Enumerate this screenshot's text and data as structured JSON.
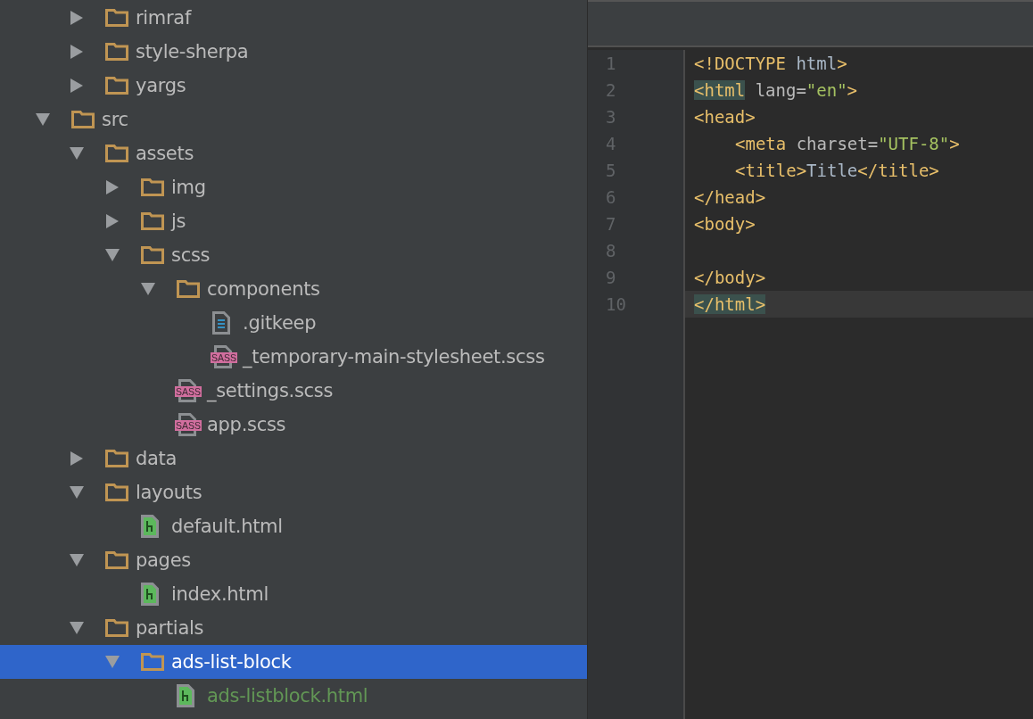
{
  "project_tree": [
    {
      "children": [
        {
          "label": "rimraf",
          "kind": "folder",
          "expanded": false,
          "selected": false
        },
        {
          "label": "style-sherpa",
          "kind": "folder",
          "expanded": false,
          "selected": false
        },
        {
          "label": "yargs",
          "kind": "folder",
          "expanded": false,
          "selected": false
        }
      ]
    },
    {
      "label": "src",
      "kind": "folder",
      "expanded": true,
      "selected": false,
      "children": [
        {
          "label": "assets",
          "kind": "folder",
          "expanded": true,
          "selected": false,
          "children": [
            {
              "label": "img",
              "kind": "folder",
              "expanded": false,
              "selected": false
            },
            {
              "label": "js",
              "kind": "folder",
              "expanded": false,
              "selected": false
            },
            {
              "label": "scss",
              "kind": "folder",
              "expanded": true,
              "selected": false,
              "children": [
                {
                  "label": "components",
                  "kind": "folder",
                  "expanded": true,
                  "selected": false,
                  "children": [
                    {
                      "label": ".gitkeep",
                      "kind": "text-file",
                      "added": false,
                      "selected": false
                    },
                    {
                      "label": "_temporary-main-stylesheet.scss",
                      "kind": "sass-file",
                      "badge": "SASS",
                      "added": false,
                      "selected": false
                    }
                  ]
                },
                {
                  "label": "_settings.scss",
                  "kind": "sass-file",
                  "badge": "SASS",
                  "added": false,
                  "selected": false
                },
                {
                  "label": "app.scss",
                  "kind": "sass-file",
                  "badge": "SASS",
                  "added": false,
                  "selected": false
                }
              ]
            }
          ]
        },
        {
          "label": "data",
          "kind": "folder",
          "expanded": false,
          "selected": false
        },
        {
          "label": "layouts",
          "kind": "folder",
          "expanded": true,
          "selected": false,
          "children": [
            {
              "label": "default.html",
              "kind": "html-file",
              "added": false,
              "selected": false
            }
          ]
        },
        {
          "label": "pages",
          "kind": "folder",
          "expanded": true,
          "selected": false,
          "children": [
            {
              "label": "index.html",
              "kind": "html-file",
              "added": false,
              "selected": false
            }
          ]
        },
        {
          "label": "partials",
          "kind": "folder",
          "expanded": true,
          "selected": false,
          "children": [
            {
              "label": "ads-list-block",
              "kind": "folder",
              "expanded": true,
              "selected": true,
              "children": [
                {
                  "label": "ads-listblock.html",
                  "kind": "html-file",
                  "added": true,
                  "selected": false
                }
              ]
            }
          ]
        }
      ]
    }
  ],
  "editor": {
    "lines": [
      {
        "number": "1",
        "indented": false,
        "current": false,
        "tag_matched": false,
        "tokens": [
          {
            "text": "<!DOCTYPE",
            "kind": "tag"
          },
          {
            "text": " html",
            "kind": "text"
          },
          {
            "text": ">",
            "kind": "tag"
          }
        ]
      },
      {
        "number": "2",
        "indented": false,
        "current": false,
        "tag_matched": true,
        "tokens": [
          {
            "text": "<html",
            "kind": "tag"
          },
          {
            "text": " lang=",
            "kind": "attr"
          },
          {
            "text": "\"en\"",
            "kind": "string"
          },
          {
            "text": ">",
            "kind": "tag"
          }
        ]
      },
      {
        "number": "3",
        "indented": false,
        "current": false,
        "tag_matched": false,
        "tokens": [
          {
            "text": "<head>",
            "kind": "tag"
          }
        ]
      },
      {
        "number": "4",
        "indented": true,
        "current": false,
        "tag_matched": false,
        "tokens": [
          {
            "text": "<meta",
            "kind": "tag"
          },
          {
            "text": " charset=",
            "kind": "attr"
          },
          {
            "text": "\"UTF-8\"",
            "kind": "string"
          },
          {
            "text": ">",
            "kind": "tag"
          }
        ]
      },
      {
        "number": "5",
        "indented": true,
        "current": false,
        "tag_matched": false,
        "tokens": [
          {
            "text": "<title>",
            "kind": "tag"
          },
          {
            "text": "Title",
            "kind": "text"
          },
          {
            "text": "</title>",
            "kind": "tag"
          }
        ]
      },
      {
        "number": "6",
        "indented": false,
        "current": false,
        "tag_matched": false,
        "tokens": [
          {
            "text": "</head>",
            "kind": "tag"
          }
        ]
      },
      {
        "number": "7",
        "indented": false,
        "current": false,
        "tag_matched": false,
        "tokens": [
          {
            "text": "<body>",
            "kind": "tag"
          }
        ]
      },
      {
        "number": "8"
      },
      {
        "number": "9",
        "indented": false,
        "current": false,
        "tag_matched": false,
        "tokens": [
          {
            "text": "</body>",
            "kind": "tag"
          }
        ]
      },
      {
        "number": "10",
        "indented": false,
        "current": true,
        "tag_matched": true,
        "tokens": [
          {
            "text": "</html>",
            "kind": "tag"
          }
        ]
      }
    ]
  }
}
